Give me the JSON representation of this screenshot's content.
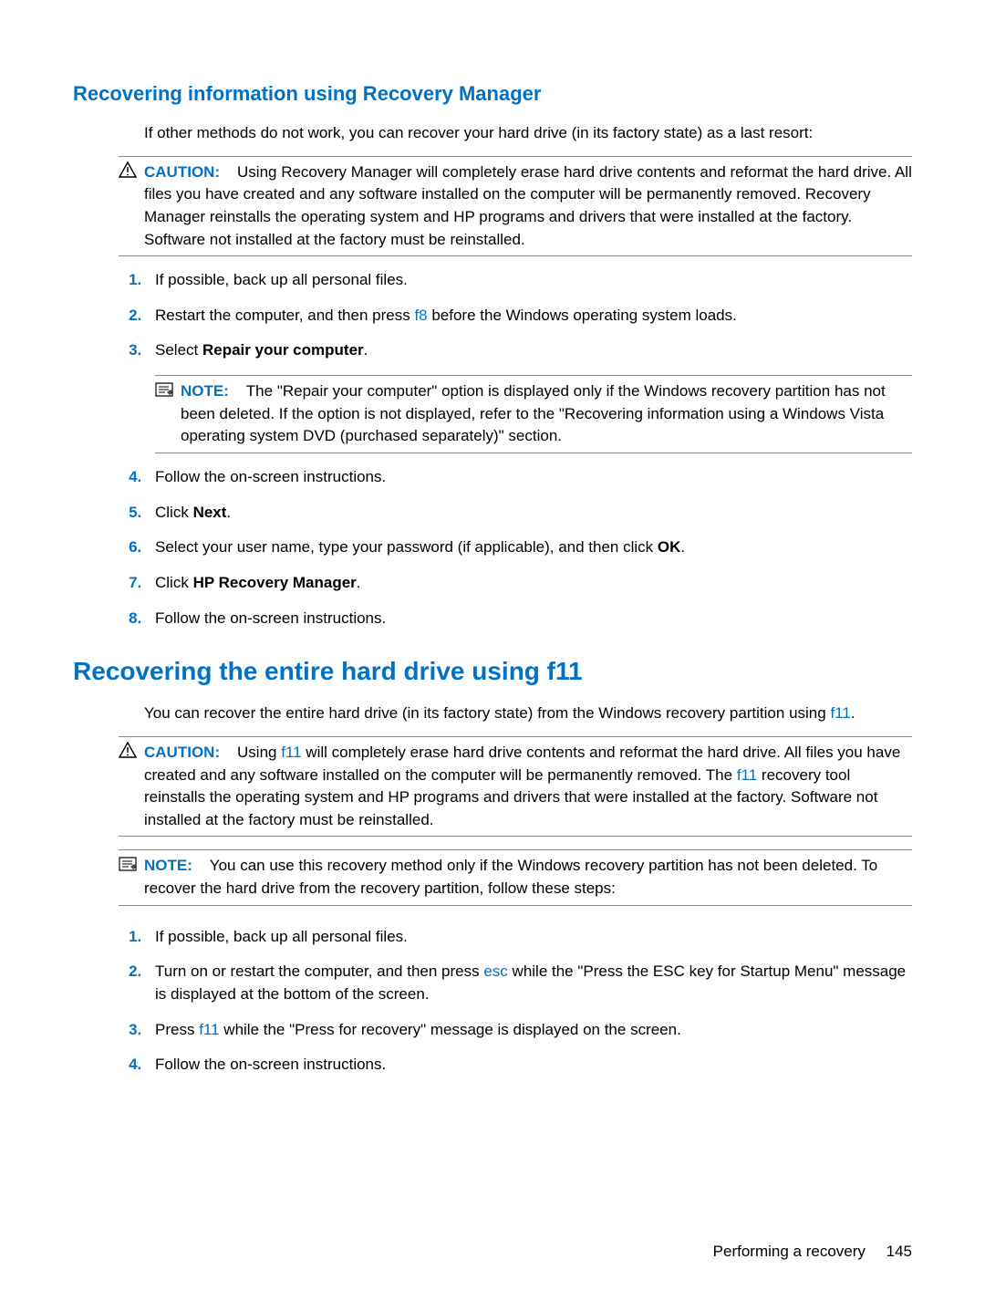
{
  "section1": {
    "heading": "Recovering information using Recovery Manager",
    "intro": "If other methods do not work, you can recover your hard drive (in its factory state) as a last resort:",
    "caution_label": "CAUTION:",
    "caution_text": "Using Recovery Manager will completely erase hard drive contents and reformat the hard drive. All files you have created and any software installed on the computer will be permanently removed. Recovery Manager reinstalls the operating system and HP programs and drivers that were installed at the factory. Software not installed at the factory must be reinstalled.",
    "step1": "If possible, back up all personal files.",
    "step2_a": "Restart the computer, and then press ",
    "step2_key": "f8",
    "step2_b": " before the Windows operating system loads.",
    "step3_a": "Select ",
    "step3_bold": "Repair your computer",
    "step3_b": ".",
    "note_label": "NOTE:",
    "note_text": "The \"Repair your computer\" option is displayed only if the Windows recovery partition has not been deleted. If the option is not displayed, refer to the \"Recovering information using a Windows Vista operating system DVD (purchased separately)\" section.",
    "step4": "Follow the on-screen instructions.",
    "step5_a": "Click ",
    "step5_bold": "Next",
    "step5_b": ".",
    "step6_a": "Select your user name, type your password (if applicable), and then click ",
    "step6_bold": "OK",
    "step6_b": ".",
    "step7_a": "Click ",
    "step7_bold": "HP Recovery Manager",
    "step7_b": ".",
    "step8": "Follow the on-screen instructions."
  },
  "section2": {
    "heading": "Recovering the entire hard drive using f11",
    "intro_a": "You can recover the entire hard drive (in its factory state) from the Windows recovery partition using ",
    "intro_key": "f11",
    "intro_b": ".",
    "caution_label": "CAUTION:",
    "caution_a": "Using ",
    "caution_key1": "f11",
    "caution_b": " will completely erase hard drive contents and reformat the hard drive. All files you have created and any software installed on the computer will be permanently removed. The ",
    "caution_key2": "f11",
    "caution_c": " recovery tool reinstalls the operating system and HP programs and drivers that were installed at the factory. Software not installed at the factory must be reinstalled.",
    "note_label": "NOTE:",
    "note_text": "You can use this recovery method only if the Windows recovery partition has not been deleted. To recover the hard drive from the recovery partition, follow these steps:",
    "step1": "If possible, back up all personal files.",
    "step2_a": "Turn on or restart the computer, and then press ",
    "step2_key": "esc",
    "step2_b": " while the \"Press the ESC key for Startup Menu\" message is displayed at the bottom of the screen.",
    "step3_a": "Press ",
    "step3_key": "f11",
    "step3_b": " while the \"Press for recovery\" message is displayed on the screen.",
    "step4": "Follow the on-screen instructions."
  },
  "footer": {
    "label": "Performing a recovery",
    "page": "145"
  }
}
